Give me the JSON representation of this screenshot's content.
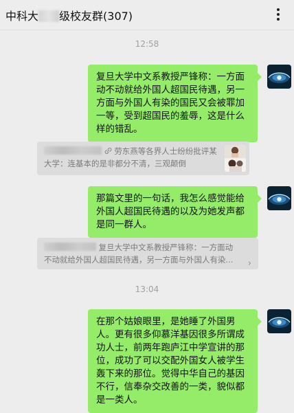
{
  "header": {
    "title_prefix": "中科大",
    "title_suffix": "级校友群(307)",
    "menu_icon": "more-horizontal-icon"
  },
  "colors": {
    "background": "#ededed",
    "sent_bubble": "#95ec69",
    "quote_bg": "#dcdcdc",
    "time_text": "#a0a0a0",
    "quote_text": "#7b7b7b"
  },
  "messages": [
    {
      "time": "12:58",
      "text": "复旦大学中文系教授严锋称：一方面动不动就给外国人超国民待遇，另一方面与外国人有染的国民又会被罪加一等，受到超国民的羞辱，这是什么样的错乱。",
      "quote": {
        "line1": "劳东燕等各界人士纷纷批评某",
        "line2": "大学：连基本的是非都分不清，三观颠倒",
        "has_link_icon": true
      }
    },
    {
      "text": "那篇文里的一句话，我怎么感觉能给外国人超国民待遇的以及为她发声都是同一群人。",
      "quote": {
        "line1": "复旦大学中文系教授严锋称：一方面动",
        "line2": "不动就给外国人超国民待遇，另一方面与外国人有染...",
        "chevron": "›"
      }
    },
    {
      "time": "13:04",
      "text": "在那个姑娘眼里，是她睡了外国男人。更有很多仰慕洋基因很多所谓成功人士，前两年跑庐江中学宣讲的那位，成功了可以交配外国女人被学生轰下来的那位。觉得中华自己的基因不行，信奉杂交改善的一类，貌似都是一类人。"
    }
  ]
}
